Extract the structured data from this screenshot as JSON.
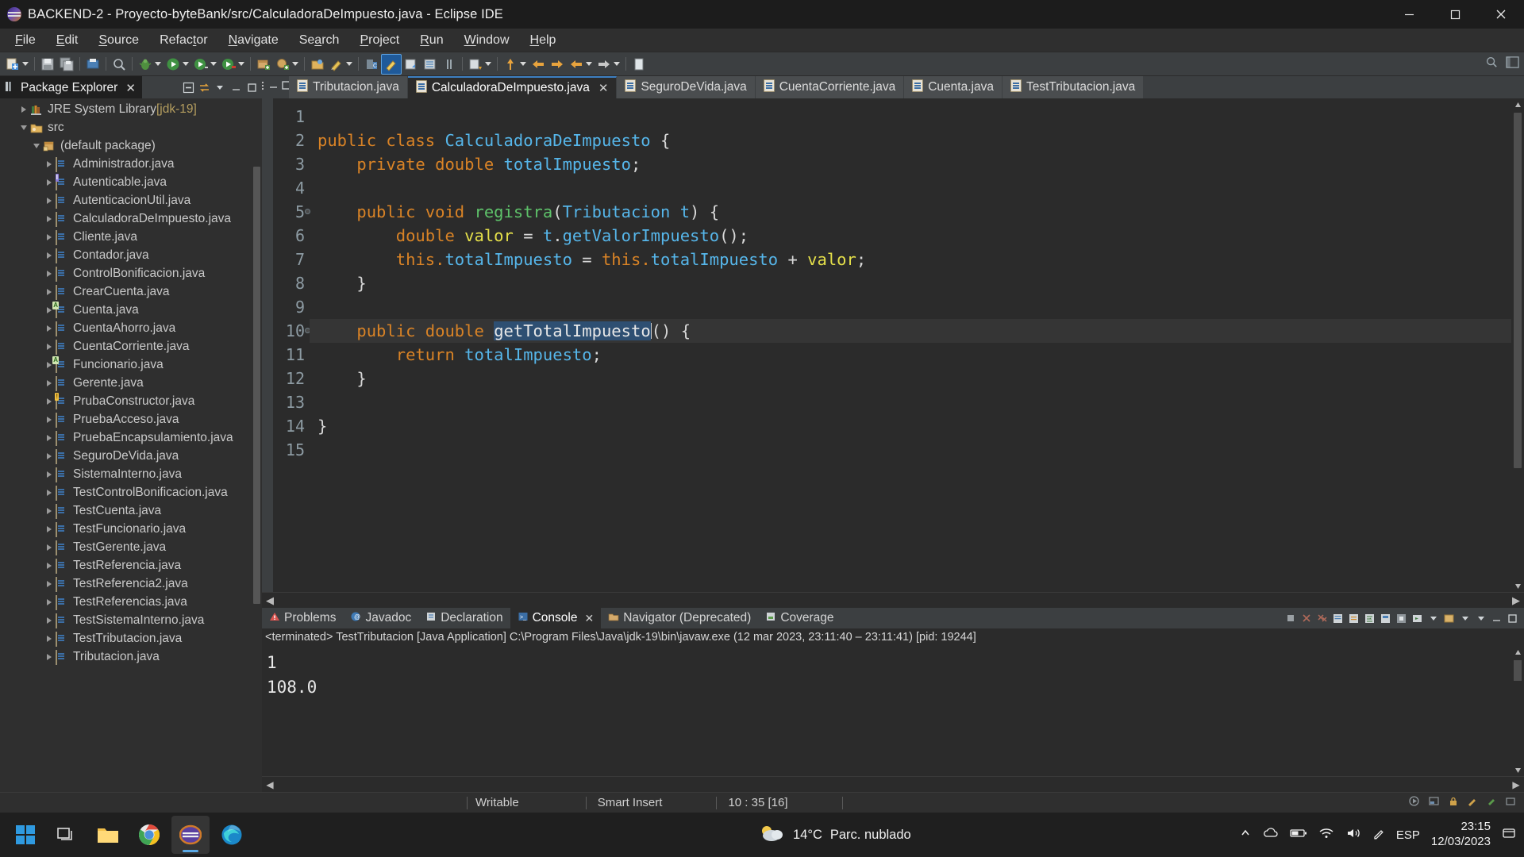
{
  "window": {
    "title": "BACKEND-2 - Proyecto-byteBank/src/CalculadoraDeImpuesto.java - Eclipse IDE",
    "app_icon": "eclipse-icon",
    "minimize": "minimize-icon",
    "maximize": "maximize-icon",
    "close": "close-icon"
  },
  "menubar": {
    "items": [
      {
        "label": "File"
      },
      {
        "label": "Edit"
      },
      {
        "label": "Source"
      },
      {
        "label": "Refactor"
      },
      {
        "label": "Navigate"
      },
      {
        "label": "Search"
      },
      {
        "label": "Project"
      },
      {
        "label": "Run"
      },
      {
        "label": "Window"
      },
      {
        "label": "Help"
      }
    ]
  },
  "toolbar": {
    "items": [
      "new-wizard-icon",
      "save-icon",
      "save-all-icon",
      "print-icon",
      "search-icon",
      "debug-icon",
      "run-icon",
      "run-last-tool-icon",
      "coverage-icon",
      "new-package-icon",
      "new-class-icon",
      "external-tools-icon",
      "pencil-icon",
      "open-type-icon",
      "open-task-icon",
      "skip-breakpoints-icon",
      "next-annotation-icon",
      "previous-annotation-icon",
      "last-edit-location-icon",
      "back-icon",
      "forward-icon",
      "pin-editor-icon"
    ],
    "right_items": [
      "quick-access-search-icon",
      "perspective-java-icon"
    ]
  },
  "package_explorer": {
    "title": "Package Explorer",
    "close_label": "✕",
    "view_icon": "package-explorer-icon",
    "tools": [
      "collapse-all-icon",
      "link-with-editor-icon",
      "view-menu-icon",
      "minimize-icon",
      "maximize-icon"
    ],
    "tree": [
      {
        "label": "JRE System Library",
        "suffix": " [jdk-19]",
        "icon": "jre-library-icon",
        "indent": 1,
        "expanded": false,
        "twisty": "collapsed"
      },
      {
        "label": "src",
        "suffix": "",
        "icon": "source-folder-icon",
        "indent": 1,
        "expanded": true,
        "twisty": "expanded"
      },
      {
        "label": "(default package)",
        "suffix": "",
        "icon": "package-icon",
        "indent": 2,
        "expanded": true,
        "twisty": "expanded"
      },
      {
        "label": "Administrador.java",
        "suffix": "",
        "icon": "java-class-icon",
        "indent": 3,
        "twisty": "collapsed",
        "badge": ""
      },
      {
        "label": "Autenticable.java",
        "suffix": "",
        "icon": "java-interface-icon",
        "indent": 3,
        "twisty": "collapsed",
        "badge": "I"
      },
      {
        "label": "AutenticacionUtil.java",
        "suffix": "",
        "icon": "java-class-icon",
        "indent": 3,
        "twisty": "collapsed",
        "badge": ""
      },
      {
        "label": "CalculadoraDeImpuesto.java",
        "suffix": "",
        "icon": "java-class-icon",
        "indent": 3,
        "twisty": "collapsed",
        "badge": ""
      },
      {
        "label": "Cliente.java",
        "suffix": "",
        "icon": "java-class-icon",
        "indent": 3,
        "twisty": "collapsed",
        "badge": ""
      },
      {
        "label": "Contador.java",
        "suffix": "",
        "icon": "java-class-icon",
        "indent": 3,
        "twisty": "collapsed",
        "badge": ""
      },
      {
        "label": "ControlBonificacion.java",
        "suffix": "",
        "icon": "java-class-icon",
        "indent": 3,
        "twisty": "collapsed",
        "badge": ""
      },
      {
        "label": "CrearCuenta.java",
        "suffix": "",
        "icon": "java-class-icon",
        "indent": 3,
        "twisty": "collapsed",
        "badge": ""
      },
      {
        "label": "Cuenta.java",
        "suffix": "",
        "icon": "java-abstract-class-icon",
        "indent": 3,
        "twisty": "collapsed",
        "badge": "A"
      },
      {
        "label": "CuentaAhorro.java",
        "suffix": "",
        "icon": "java-class-icon",
        "indent": 3,
        "twisty": "collapsed",
        "badge": ""
      },
      {
        "label": "CuentaCorriente.java",
        "suffix": "",
        "icon": "java-class-icon",
        "indent": 3,
        "twisty": "collapsed",
        "badge": ""
      },
      {
        "label": "Funcionario.java",
        "suffix": "",
        "icon": "java-abstract-class-icon",
        "indent": 3,
        "twisty": "collapsed",
        "badge": "A"
      },
      {
        "label": "Gerente.java",
        "suffix": "",
        "icon": "java-class-icon",
        "indent": 3,
        "twisty": "collapsed",
        "badge": ""
      },
      {
        "label": "PrubaConstructor.java",
        "suffix": "",
        "icon": "java-class-warning-icon",
        "indent": 3,
        "twisty": "collapsed",
        "badge": "W"
      },
      {
        "label": "PruebaAcceso.java",
        "suffix": "",
        "icon": "java-class-icon",
        "indent": 3,
        "twisty": "collapsed",
        "badge": ""
      },
      {
        "label": "PruebaEncapsulamiento.java",
        "suffix": "",
        "icon": "java-class-icon",
        "indent": 3,
        "twisty": "collapsed",
        "badge": ""
      },
      {
        "label": "SeguroDeVida.java",
        "suffix": "",
        "icon": "java-class-icon",
        "indent": 3,
        "twisty": "collapsed",
        "badge": ""
      },
      {
        "label": "SistemaInterno.java",
        "suffix": "",
        "icon": "java-class-icon",
        "indent": 3,
        "twisty": "collapsed",
        "badge": ""
      },
      {
        "label": "TestControlBonificacion.java",
        "suffix": "",
        "icon": "java-class-icon",
        "indent": 3,
        "twisty": "collapsed",
        "badge": ""
      },
      {
        "label": "TestCuenta.java",
        "suffix": "",
        "icon": "java-class-icon",
        "indent": 3,
        "twisty": "collapsed",
        "badge": ""
      },
      {
        "label": "TestFuncionario.java",
        "suffix": "",
        "icon": "java-class-icon",
        "indent": 3,
        "twisty": "collapsed",
        "badge": ""
      },
      {
        "label": "TestGerente.java",
        "suffix": "",
        "icon": "java-class-icon",
        "indent": 3,
        "twisty": "collapsed",
        "badge": ""
      },
      {
        "label": "TestReferencia.java",
        "suffix": "",
        "icon": "java-class-icon",
        "indent": 3,
        "twisty": "collapsed",
        "badge": ""
      },
      {
        "label": "TestReferencia2.java",
        "suffix": "",
        "icon": "java-class-icon",
        "indent": 3,
        "twisty": "collapsed",
        "badge": ""
      },
      {
        "label": "TestReferencias.java",
        "suffix": "",
        "icon": "java-class-icon",
        "indent": 3,
        "twisty": "collapsed",
        "badge": ""
      },
      {
        "label": "TestSistemaInterno.java",
        "suffix": "",
        "icon": "java-class-icon",
        "indent": 3,
        "twisty": "collapsed",
        "badge": ""
      },
      {
        "label": "TestTributacion.java",
        "suffix": "",
        "icon": "java-class-icon",
        "indent": 3,
        "twisty": "collapsed",
        "badge": ""
      },
      {
        "label": "Tributacion.java",
        "suffix": "",
        "icon": "java-class-icon",
        "indent": 3,
        "twisty": "collapsed",
        "badge": ""
      }
    ]
  },
  "editor": {
    "tabs": [
      {
        "label": "Tributacion.java",
        "active": false,
        "closable": false
      },
      {
        "label": "CalculadoraDeImpuesto.java",
        "active": true,
        "closable": true
      },
      {
        "label": "SeguroDeVida.java",
        "active": false,
        "closable": false
      },
      {
        "label": "CuentaCorriente.java",
        "active": false,
        "closable": false
      },
      {
        "label": "Cuenta.java",
        "active": false,
        "closable": false
      },
      {
        "label": "TestTributacion.java",
        "active": false,
        "closable": false
      }
    ],
    "lines": [
      {
        "n": "1",
        "marker": false,
        "current": false
      },
      {
        "n": "2",
        "marker": false,
        "current": false
      },
      {
        "n": "3",
        "marker": false,
        "current": false
      },
      {
        "n": "4",
        "marker": false,
        "current": false
      },
      {
        "n": "5",
        "marker": true,
        "current": false
      },
      {
        "n": "6",
        "marker": false,
        "current": false
      },
      {
        "n": "7",
        "marker": false,
        "current": false
      },
      {
        "n": "8",
        "marker": false,
        "current": false
      },
      {
        "n": "9",
        "marker": false,
        "current": false
      },
      {
        "n": "10",
        "marker": true,
        "current": true
      },
      {
        "n": "11",
        "marker": false,
        "current": false
      },
      {
        "n": "12",
        "marker": false,
        "current": false
      },
      {
        "n": "13",
        "marker": false,
        "current": false
      },
      {
        "n": "14",
        "marker": false,
        "current": false
      },
      {
        "n": "15",
        "marker": false,
        "current": false
      }
    ],
    "code_text": {
      "l1": "",
      "l2_kw1": "public",
      "l2_kw2": "class",
      "l2_type": "CalculadoraDeImpuesto",
      "l2_brace": "{",
      "l3_kw1": "private",
      "l3_kw2": "double",
      "l3_field": "totalImpuesto",
      "l3_semi": ";",
      "l4": "",
      "l5_kw1": "public",
      "l5_kw2": "void",
      "l5_method": "registra",
      "l5_paren1": "(",
      "l5_type": "Tributacion",
      "l5_param": "t",
      "l5_paren2": ")",
      "l5_brace": "{",
      "l6_kw": "double",
      "l6_var": "valor",
      "l6_eq": "=",
      "l6_obj": "t",
      "l6_dot": ".",
      "l6_call": "getValorImpuesto",
      "l6_tail": "();",
      "l7_kw1": "this",
      "l7_dot1": ".",
      "l7_f1": "totalImpuesto",
      "l7_eq": "=",
      "l7_kw2": "this",
      "l7_dot2": ".",
      "l7_f2": "totalImpuesto",
      "l7_plus": "+",
      "l7_var": "valor",
      "l7_semi": ";",
      "l8_brace": "}",
      "l9": "",
      "l10_kw1": "public",
      "l10_kw2": "double",
      "l10_method": "getTotalImpuesto",
      "l10_tail": "() {",
      "l11_kw": "return",
      "l11_field": "totalImpuesto",
      "l11_semi": ";",
      "l12_brace": "}",
      "l13": "",
      "l14_brace": "}",
      "l15": ""
    },
    "selection": "getTotalImpuesto"
  },
  "bottom_panel": {
    "tabs": [
      {
        "label": "Problems",
        "icon": "problems-icon",
        "active": false
      },
      {
        "label": "Javadoc",
        "icon": "javadoc-icon",
        "active": false
      },
      {
        "label": "Declaration",
        "icon": "declaration-icon",
        "active": false
      },
      {
        "label": "Console",
        "icon": "console-icon",
        "active": true,
        "closable": true
      },
      {
        "label": "Navigator (Deprecated)",
        "icon": "navigator-icon",
        "active": false
      },
      {
        "label": "Coverage",
        "icon": "coverage-icon",
        "active": false
      }
    ],
    "tools": [
      "terminate-icon",
      "remove-launch-icon",
      "remove-all-terminated-icon",
      "clear-console-icon",
      "scroll-lock-icon",
      "word-wrap-icon",
      "show-console-icon",
      "pin-console-icon",
      "display-selected-console-icon",
      "open-console-icon",
      "view-menu-icon",
      "minimize-icon",
      "maximize-icon"
    ],
    "console_header": "<terminated> TestTributacion [Java Application] C:\\Program Files\\Java\\jdk-19\\bin\\javaw.exe  (12 mar 2023, 23:11:40 – 23:11:41) [pid: 19244]",
    "console_output": [
      "1",
      "108.0"
    ]
  },
  "statusbar": {
    "writable": "Writable",
    "insert_mode": "Smart Insert",
    "position": "10 : 35 [16]",
    "right_icons": [
      "build-icon",
      "heap-status-icon",
      "lock-icon",
      "edit-icon",
      "pencil-icon",
      "notification-icon"
    ]
  },
  "taskbar": {
    "start": "windows-start-icon",
    "apps": [
      {
        "name": "task-view-icon",
        "active": false
      },
      {
        "name": "file-explorer-icon",
        "active": false
      },
      {
        "name": "chrome-icon",
        "active": false
      },
      {
        "name": "eclipse-icon",
        "active": true
      },
      {
        "name": "edge-icon",
        "active": false
      }
    ],
    "weather": {
      "icon": "cloudy-icon",
      "temperature": "14°C",
      "condition": "Parc. nublado"
    },
    "tray": [
      "show-hidden-icons-icon",
      "onedrive-icon",
      "battery-icon",
      "wifi-icon",
      "volume-icon",
      "pen-icon"
    ],
    "language": "ESP",
    "clock_time": "23:15",
    "clock_date": "12/03/2023",
    "notification": "notification-center-icon"
  },
  "colors": {
    "keyword": "#d98326",
    "type": "#56b6ea",
    "method": "#5ec26a",
    "localvar": "#e5e04a",
    "selection": "#2e4f72",
    "active_tab_border": "#3d7fc1",
    "editor_bg": "#2b2b2b",
    "chrome_bg": "#2f2f2f"
  }
}
